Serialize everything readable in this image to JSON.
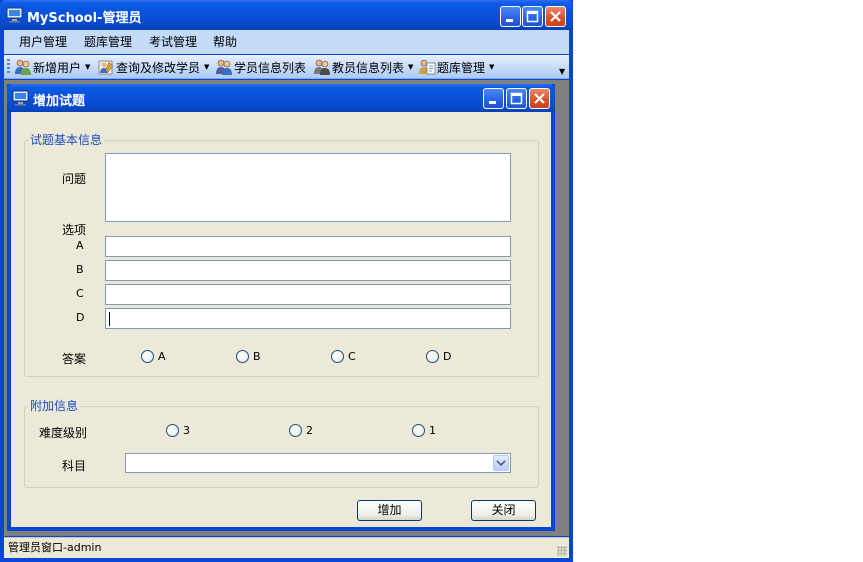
{
  "main_window": {
    "title": "MySchool-管理员",
    "controls": {
      "minimize": "minimize",
      "maximize": "maximize",
      "close": "close"
    }
  },
  "menu": {
    "items": [
      "用户管理",
      "题库管理",
      "考试管理",
      "帮助"
    ]
  },
  "toolbar": {
    "items": [
      {
        "label": "新增用户",
        "icon": "add-user-icon",
        "has_dropdown": true
      },
      {
        "label": "查询及修改学员",
        "icon": "edit-student-icon",
        "has_dropdown": true
      },
      {
        "label": "学员信息列表",
        "icon": "student-list-icon",
        "has_dropdown": false
      },
      {
        "label": "教员信息列表",
        "icon": "teacher-list-icon",
        "has_dropdown": true
      },
      {
        "label": "题库管理",
        "icon": "question-bank-icon",
        "has_dropdown": true
      }
    ]
  },
  "dialog": {
    "title": "增加试题",
    "basic_group": {
      "title": "试题基本信息",
      "question_label": "问题",
      "question_value": "",
      "options_label": "选项",
      "options": [
        {
          "label": "A",
          "value": ""
        },
        {
          "label": "B",
          "value": ""
        },
        {
          "label": "C",
          "value": ""
        },
        {
          "label": "D",
          "value": ""
        }
      ],
      "answer_label": "答案",
      "answer_choices": [
        "A",
        "B",
        "C",
        "D"
      ],
      "answer_selected": null
    },
    "extra_group": {
      "title": "附加信息",
      "difficulty_label": "难度级别",
      "difficulty_choices": [
        "3",
        "2",
        "1"
      ],
      "difficulty_selected": null,
      "subject_label": "科目",
      "subject_value": ""
    },
    "buttons": {
      "add": "增加",
      "close": "关闭"
    }
  },
  "statusbar": {
    "text": "管理员窗口-admin"
  },
  "colors": {
    "titlebar": "#0a4fd8",
    "menubar": "#c3daf9",
    "dialog_bg": "#ece9d8",
    "group_title": "#1a4bbd"
  }
}
